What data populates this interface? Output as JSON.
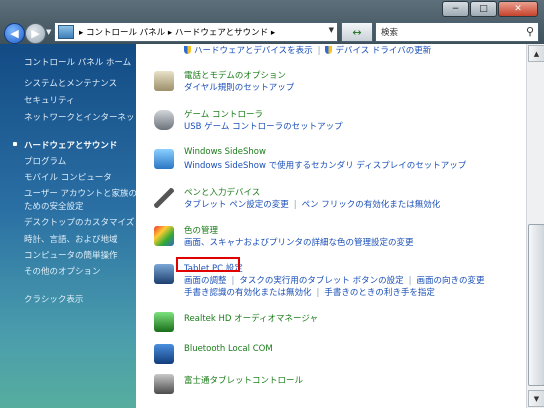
{
  "window": {
    "minimize": "−",
    "maximize": "□",
    "close": "✕"
  },
  "toolbar": {
    "address": "▸ コントロール パネル ▸ ハードウェアとサウンド ▸",
    "refresh": "↔",
    "search_placeholder": "検索"
  },
  "sidebar": {
    "home": "コントロール パネル ホーム",
    "items": [
      "システムとメンテナンス",
      "セキュリティ",
      "ネットワークとインターネット",
      "ハードウェアとサウンド",
      "プログラム",
      "モバイル コンピュータ",
      "ユーザー アカウントと家族の",
      "ための安全設定",
      "デスクトップのカスタマイズ",
      "時計、言語、および地域",
      "コンピュータの簡単操作",
      "その他のオプション"
    ],
    "classic": "クラシック表示",
    "selected": "ハードウェアとサウンド"
  },
  "main": {
    "top_links": [
      "ハードウェアとデバイスを表示",
      "デバイス ドライバの更新"
    ],
    "items": [
      {
        "title": "電話とモデムのオプション",
        "links": [
          "ダイヤル規則のセットアップ"
        ]
      },
      {
        "title": "ゲーム コントローラ",
        "links": [
          "USB ゲーム コントローラのセットアップ"
        ]
      },
      {
        "title": "Windows SideShow",
        "links": [
          "Windows SideShow で使用するセカンダリ ディスプレイのセットアップ"
        ]
      },
      {
        "title": "ペンと入力デバイス",
        "links": [
          "タブレット ペン設定の変更",
          "ペン フリックの有効化または無効化"
        ]
      },
      {
        "title": "色の管理",
        "links": [
          "画面、スキャナおよびプリンタの詳細な色の管理設定の変更"
        ]
      },
      {
        "title": "Tablet PC 設定",
        "links": [
          "画面の調整",
          "タスクの実行用のタブレット ボタンの設定",
          "画面の向きの変更"
        ],
        "links2": [
          "手書き認識の有効化または無効化",
          "手書きのときの利き手を指定"
        ]
      },
      {
        "title": "Realtek HD オーディオマネージャ",
        "links": []
      },
      {
        "title": "Bluetooth Local COM",
        "links": []
      },
      {
        "title": "富士通タブレットコントロール",
        "links": []
      }
    ]
  },
  "colors": {
    "accent": "#1a7c1a",
    "link": "#1a4fb8",
    "highlight": "#e00000"
  }
}
